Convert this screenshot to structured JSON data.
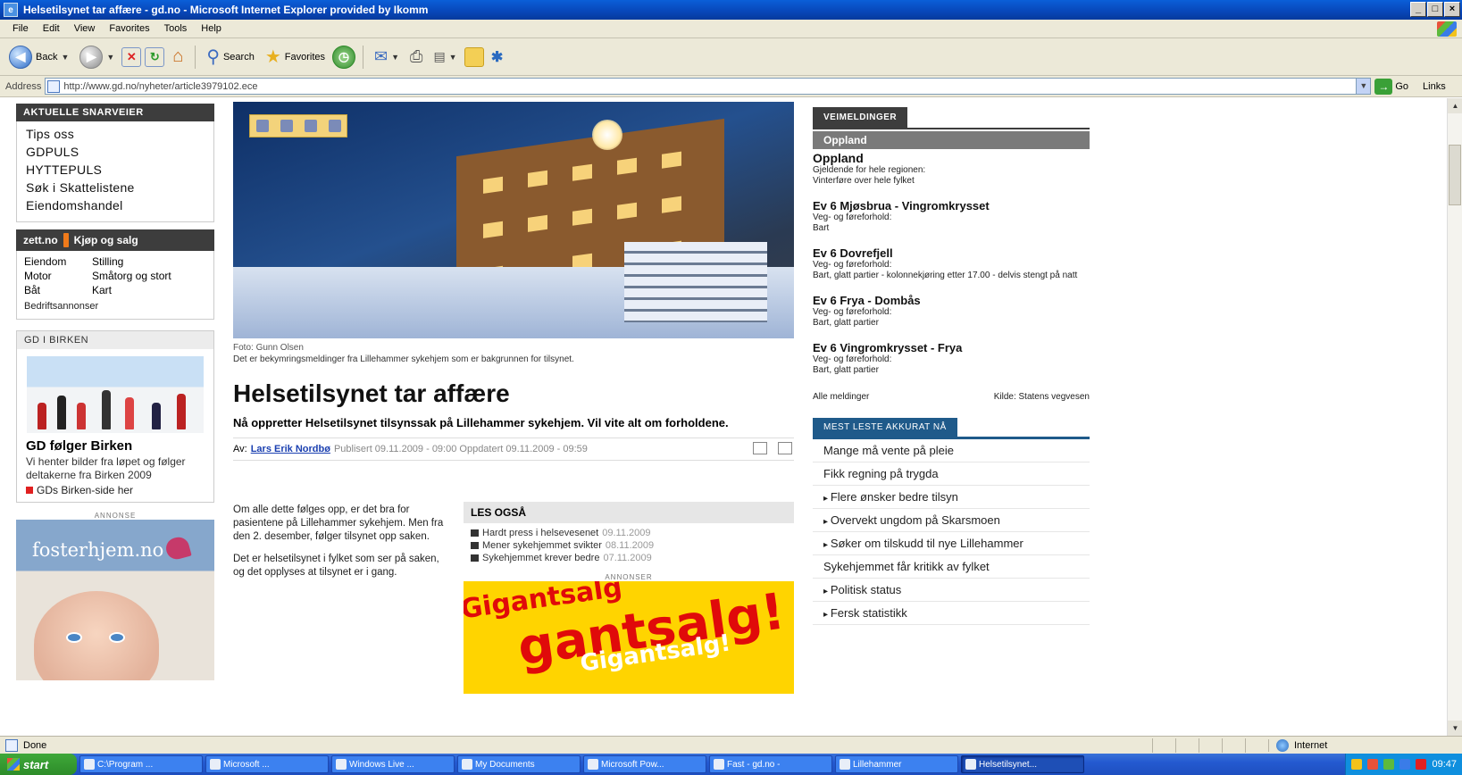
{
  "window": {
    "title": "Helsetilsynet tar affære - gd.no - Microsoft Internet Explorer provided by Ikomm",
    "min": "_",
    "max": "□",
    "close": "×"
  },
  "menu": [
    "File",
    "Edit",
    "View",
    "Favorites",
    "Tools",
    "Help"
  ],
  "toolbar": {
    "back": "Back",
    "search": "Search",
    "favorites": "Favorites"
  },
  "address": {
    "label": "Address",
    "url": "http://www.gd.no/nyheter/article3979102.ece",
    "go": "Go",
    "links": "Links"
  },
  "left": {
    "quick_header": "AKTUELLE SNARVEIER",
    "quick_links": [
      "Tips oss",
      "GDPULS",
      "HYTTEPULS",
      "Søk i Skattelistene",
      "Eiendomshandel"
    ],
    "zett_logo": "zett.no",
    "zett_title": "Kjøp og salg",
    "zett_items": [
      "Eiendom",
      "Stilling",
      "Motor",
      "Småtorg og stort",
      "Båt",
      "Kart"
    ],
    "zett_bottom": "Bedriftsannonser",
    "gd_header": "GD I BIRKEN",
    "gd_title": "GD følger Birken",
    "gd_text": "Vi henter bilder fra løpet og følger deltakerne fra Birken 2009",
    "gd_link": "GDs Birken-side her",
    "ad_label": "ANNONSE",
    "foster_text": "fosterhjem.no"
  },
  "article": {
    "caption": "Foto: Gunn Olsen",
    "caption_text": "Det er bekymringsmeldinger fra Lillehammer sykehjem som er bakgrunnen for tilsynet.",
    "headline": "Helsetilsynet tar affære",
    "ingress": "Nå oppretter Helsetilsynet tilsynssak på Lillehammer sykehjem. Vil vite alt om forholdene.",
    "byline_prefix": "Av:",
    "author": "Lars Erik Nordbø",
    "meta": "Publisert 09.11.2009 - 09:00 Oppdatert 09.11.2009 - 09:59",
    "body": [
      "Om alle dette følges opp, er det bra for pasientene på Lillehammer sykehjem. Men fra den 2. desember, følger tilsynet opp saken.",
      "Det er helsetilsynet i fylket som ser på saken, og det opplyses at tilsynet er i gang."
    ],
    "lesogsa_header": "LES OGSÅ",
    "lesogsa_items": [
      {
        "title": "Hardt press i helsevesenet",
        "src": "09.11.2009"
      },
      {
        "title": "Mener sykehjemmet svikter",
        "src": "08.11.2009"
      },
      {
        "title": "Sykehjemmet krever bedre",
        "src": "07.11.2009"
      }
    ],
    "ann_label": "ANNONSER",
    "giga1": "Gigantsalg",
    "giga2": "gantsalg!",
    "giga3": "Gigantsalg!"
  },
  "right": {
    "veimeld_tab": "VEIMELDINGER",
    "oppland_tab": "Oppland",
    "region": "Oppland",
    "region_note": "Gjeldende for hele regionen:",
    "region_note2": "Vinterføre over hele fylket",
    "roads": [
      {
        "title": "Ev 6 Mjøsbrua - Vingromkrysset",
        "l1": "Veg- og føreforhold:",
        "l2": "Bart"
      },
      {
        "title": "Ev 6 Dovrefjell",
        "l1": "Veg- og føreforhold:",
        "l2": "Bart, glatt partier - kolonnekjøring etter 17.00 - delvis stengt på natt"
      },
      {
        "title": "Ev 6 Fryа - Dombås",
        "l1": "Veg- og føreforhold:",
        "l2": "Bart, glatt partier"
      },
      {
        "title": "Ev 6 Vingromkrysset - Fryа",
        "l1": "Veg- og føreforhold:",
        "l2": "Bart, glatt partier"
      }
    ],
    "all_meld": "Alle meldinger",
    "kilde": "Kilde: Statens vegvesen",
    "trafikk_tab": "MEST LESTE AKKURAT NÅ",
    "news": [
      {
        "t": "Mange må vente på pleie",
        "b": false
      },
      {
        "t": "Fikk regning på trygda",
        "b": false
      },
      {
        "t": "Flere ønsker bedre tilsyn",
        "b": true
      },
      {
        "t": "Overvekt ungdom på Skarsmoen",
        "b": true
      },
      {
        "t": "Søker om tilskudd til nye Lillehammer",
        "b": true
      },
      {
        "t": "Sykehjemmet får kritikk av fylket",
        "b": false
      },
      {
        "t": "Politisk status",
        "b": true
      },
      {
        "t": "Fersk statistikk",
        "b": true
      }
    ]
  },
  "status": {
    "done": "Done",
    "zone": "Internet"
  },
  "taskbar": {
    "start": "start",
    "tasks": [
      "C:\\Program ...",
      "Microsoft ...",
      "Windows Live ...",
      "My Documents",
      "Microsoft Pow...",
      "Fast - gd.no -",
      "Lillehammer",
      "Helsetilsynet..."
    ],
    "clock": "09:47"
  },
  "colors": {
    "accent": "#0a5fd8",
    "dark_header": "#3d3d3d",
    "traffic_blue": "#1f5a8a",
    "ad_yellow": "#ffd400",
    "ad_red": "#e00a0a"
  }
}
